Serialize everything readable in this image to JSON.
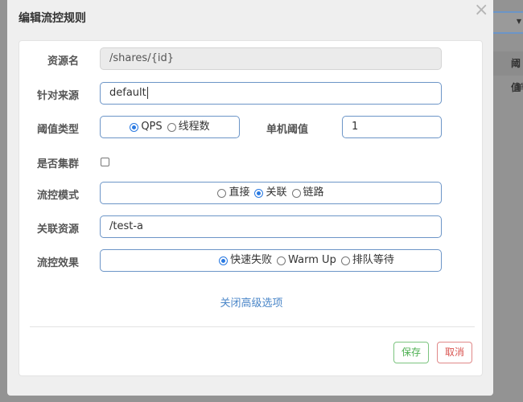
{
  "background": {
    "header_label": "阈值",
    "cell_text": "单"
  },
  "dialog": {
    "title": "编辑流控规则",
    "close_icon": "×"
  },
  "form": {
    "resource": {
      "label": "资源名",
      "value": "/shares/{id}"
    },
    "limit_app": {
      "label": "针对来源",
      "value": "default"
    },
    "grade": {
      "label": "阈值类型",
      "options": [
        {
          "label": "QPS",
          "selected": true
        },
        {
          "label": "线程数",
          "selected": false
        }
      ]
    },
    "count": {
      "label": "单机阈值",
      "value": "1"
    },
    "cluster": {
      "label": "是否集群",
      "checked": false
    },
    "strategy": {
      "label": "流控模式",
      "options": [
        {
          "label": "直接",
          "selected": false
        },
        {
          "label": "关联",
          "selected": true
        },
        {
          "label": "链路",
          "selected": false
        }
      ]
    },
    "ref_resource": {
      "label": "关联资源",
      "value": "/test-a"
    },
    "control_behavior": {
      "label": "流控效果",
      "options": [
        {
          "label": "快速失败",
          "selected": true
        },
        {
          "label": "Warm Up",
          "selected": false
        },
        {
          "label": "排队等待",
          "selected": false
        }
      ]
    }
  },
  "advanced_link": "关闭高级选项",
  "buttons": {
    "save": "保存",
    "cancel": "取消"
  },
  "colors": {
    "accent": "#2a7ae2",
    "save": "#4caf50",
    "cancel": "#d9534f",
    "link": "#4a86c8"
  }
}
